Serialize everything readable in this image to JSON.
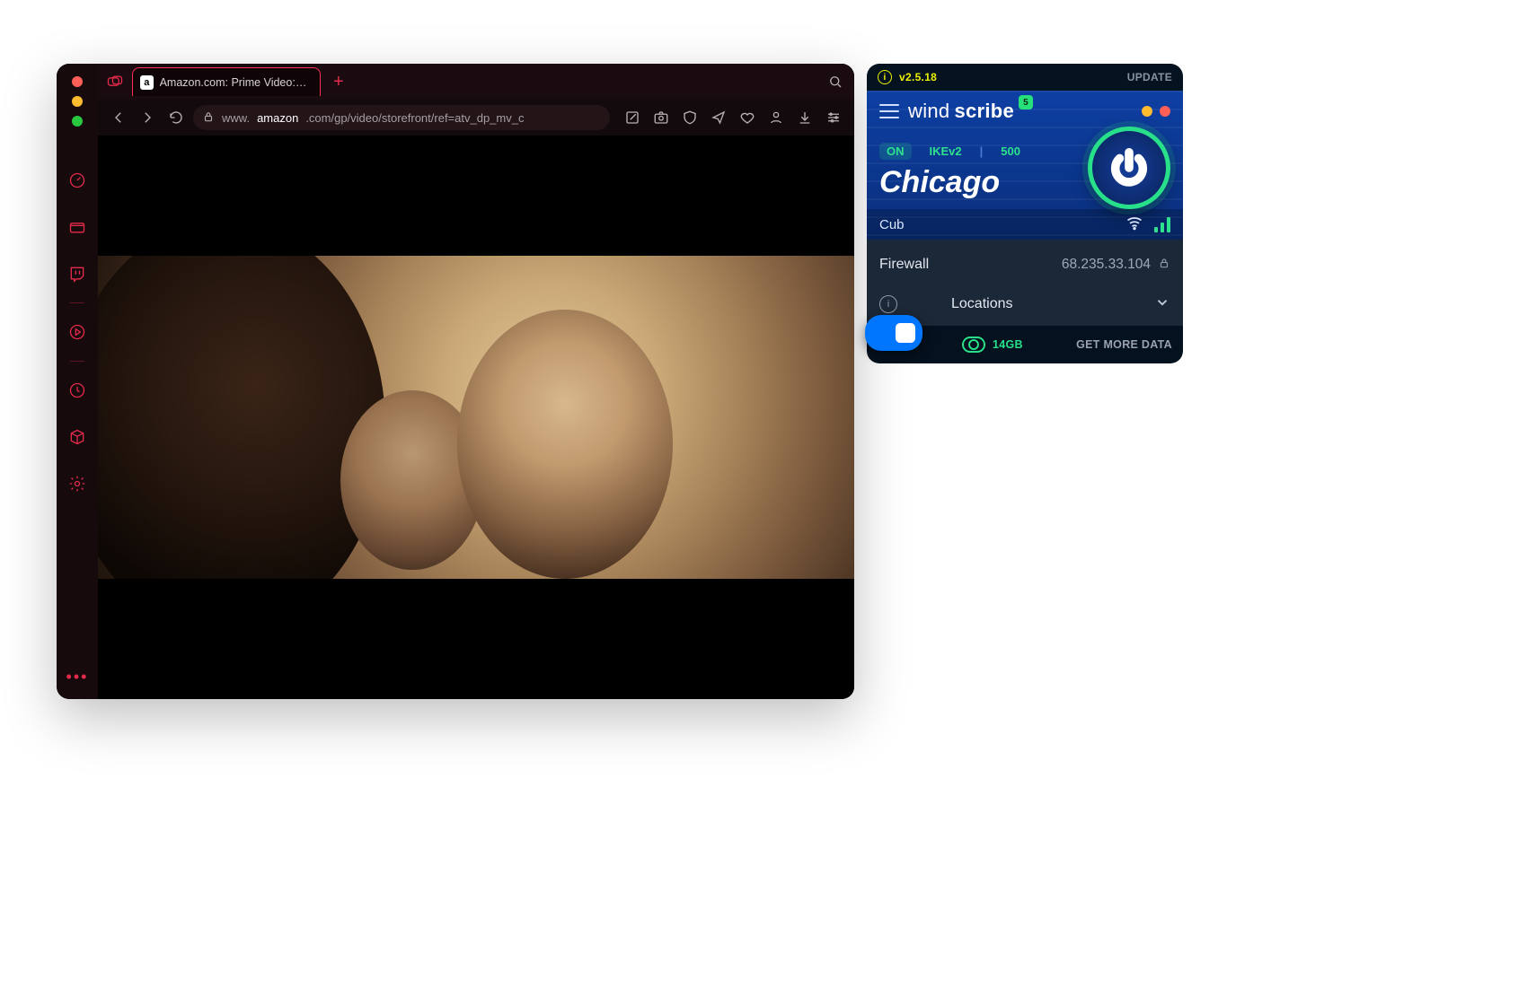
{
  "browser": {
    "tab": {
      "favicon_letter": "a",
      "title": "Amazon.com: Prime Video: Prim"
    },
    "url": {
      "scheme": "www.",
      "host": "amazon",
      "rest": ".com/gp/video/storefront/ref=atv_dp_mv_c"
    },
    "new_tab_symbol": "+"
  },
  "vpn": {
    "version": "v2.5.18",
    "update_label": "UPDATE",
    "brand_prefix": "wind",
    "brand_suffix": "scribe",
    "notif_badge": "5",
    "status_on": "ON",
    "protocol": "IKEv2",
    "port": "500",
    "city": "Chicago",
    "server_sub": "Cub",
    "firewall_label": "Firewall",
    "ip": "68.235.33.104",
    "locations_label": "Locations",
    "data_remaining": "14GB",
    "get_more": "GET MORE DATA"
  }
}
